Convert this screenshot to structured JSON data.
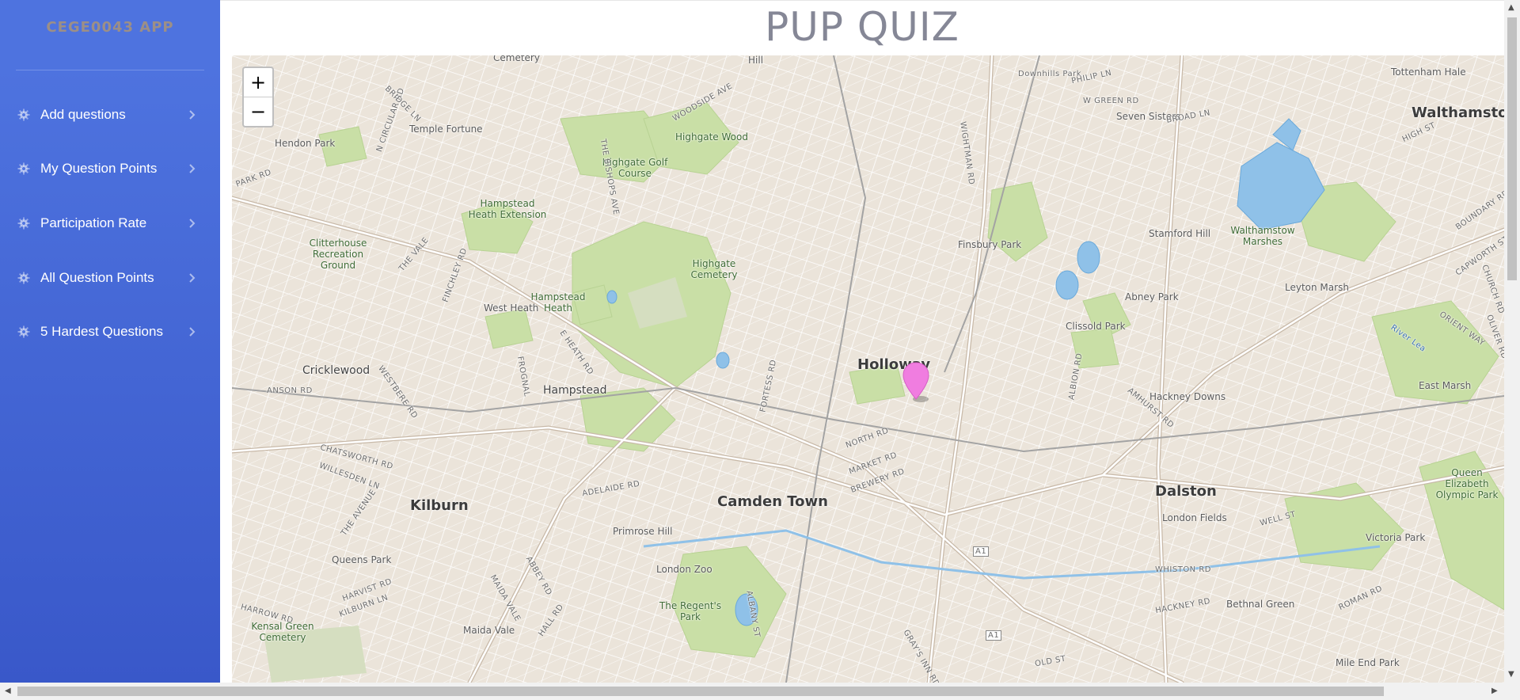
{
  "brand": "CEGE0043 APP",
  "page_title": "PUP QUIZ",
  "sidebar": {
    "items": [
      {
        "label": "Add questions",
        "icon": "gear-icon"
      },
      {
        "label": "My Question Points",
        "icon": "gear-icon"
      },
      {
        "label": "Participation Rate",
        "icon": "gear-icon"
      },
      {
        "label": "All Question Points",
        "icon": "gear-icon"
      },
      {
        "label": "5 Hardest Questions",
        "icon": "gear-icon"
      }
    ]
  },
  "colors": {
    "sidebar_top": "#4e73df",
    "sidebar_bottom": "#3958c9",
    "marker": "#f07de0",
    "title": "#858796"
  },
  "map": {
    "zoom_in": "+",
    "zoom_out": "−",
    "labels": {
      "major": [
        "Walthamstow",
        "Holloway",
        "Camden Town",
        "Kilburn",
        "Dalston"
      ],
      "areas": [
        "Hampstead",
        "Cricklewood",
        "West Heath",
        "Hendon Park",
        "Temple Fortune",
        "Tottenham Hale",
        "Seven Sisters",
        "Stamford Hill",
        "Leyton Marsh",
        "East Marsh",
        "Hackney Downs",
        "London Fields",
        "Victoria Park",
        "Queens Park",
        "Maida Vale",
        "Primrose Hill",
        "London Zoo",
        "Bethnal Green",
        "Mile End Park",
        "Abney Park",
        "Clissold Park",
        "Finsbury Park"
      ],
      "parks": [
        "Hampstead Heath",
        "Hampstead Heath Extension",
        "Highgate Golf Course",
        "Highgate Wood",
        "Highgate Cemetery",
        "Clitterhouse Recreation Ground",
        "The Regent's Park",
        "Kensal Green Cemetery",
        "Walthamstow Marshes",
        "Queen Elizabeth Olympic Park"
      ],
      "roads": [
        "Downhills Park",
        "PHILIP LN",
        "W GREEN RD",
        "BROAD LN",
        "HIGH ST",
        "BOUNDARY RD",
        "CAPWORTH ST",
        "CHURCH RD",
        "ORIENT WAY",
        "OLIVER RD",
        "WOODSIDE AVE",
        "N CIRCULAR RD",
        "BRIDGE LN",
        "PARK RD",
        "THE BISHOPS AVE",
        "WIGHTMAN RD",
        "THE VALE",
        "FINCHLEY RD",
        "E HEATH RD",
        "FORTESS RD",
        "ALBION RD",
        "AMHURST RD",
        "ANSON RD",
        "WESTBERE RD",
        "FROGNAL",
        "CHATSWORTH RD",
        "WILLESDEN LN",
        "NORTH RD",
        "MARKET RD",
        "BREWERY RD",
        "ADELAIDE RD",
        "THE AVENUE",
        "ABBEY RD",
        "HARVIST RD",
        "KILBURN LN",
        "MAIDA VALE",
        "HALL RD",
        "ALBANY ST",
        "HARROW RD",
        "GRAY'S INN RD",
        "WHISTON RD",
        "HACKNEY RD",
        "ROMAN RD",
        "OLD ST",
        "WELL ST",
        "A1",
        "River Lea",
        "Cemetery",
        "Hill"
      ]
    }
  }
}
